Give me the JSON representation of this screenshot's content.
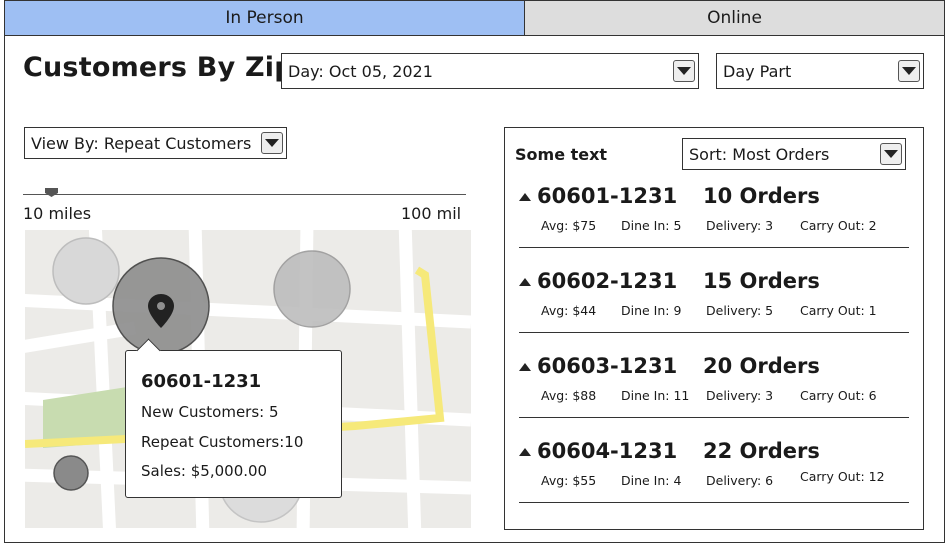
{
  "tabs": [
    {
      "label": "In Person",
      "active": true
    },
    {
      "label": "Online",
      "active": false
    }
  ],
  "title": "Customers By Zip",
  "filters": {
    "day": "Day: Oct 05, 2021",
    "day_part": "Day Part",
    "view_by": "View By: Repeat Customers"
  },
  "slider": {
    "min_label": "10 miles",
    "max_label": "100 mil",
    "value_fraction": 0.05
  },
  "tooltip": {
    "zip": "60601-1231",
    "new_customers": "New Customers: 5",
    "repeat_customers": "Repeat Customers:10",
    "sales": "Sales: $5,000.00"
  },
  "panel": {
    "title": "Some text",
    "sort": "Sort: Most Orders",
    "items": [
      {
        "zip": "60601-1231",
        "orders": "10 Orders",
        "avg": "Avg: $75",
        "dine_in": "Dine In: 5",
        "delivery": "Delivery: 3",
        "carry_out": "Carry Out: 2"
      },
      {
        "zip": "60602-1231",
        "orders": "15 Orders",
        "avg": "Avg: $44",
        "dine_in": "Dine In: 9",
        "delivery": "Delivery: 5",
        "carry_out": "Carry Out: 1"
      },
      {
        "zip": "60603-1231",
        "orders": "20 Orders",
        "avg": "Avg: $88",
        "dine_in": "Dine In: 11",
        "delivery": "Delivery: 3",
        "carry_out": "Carry Out: 6"
      },
      {
        "zip": "60604-1231",
        "orders": "22 Orders",
        "avg": "Avg: $55",
        "dine_in": "Dine In: 4",
        "delivery": "Delivery: 6",
        "carry_out": "Carry Out: 12"
      }
    ]
  },
  "icons": {
    "map_pin": "map-pin-icon",
    "dropdown": "chevron-down-icon",
    "sort_order": "triangle-up-icon"
  },
  "colors": {
    "active_tab": "#9ebff3",
    "inactive_tab": "#dddddd",
    "map_background": "#ecebe8",
    "road": "#f6e97a",
    "park": "#c8dcb0"
  }
}
